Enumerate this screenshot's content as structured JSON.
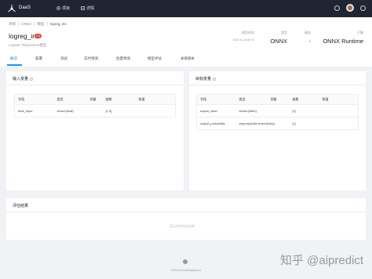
{
  "app": {
    "brand": "DaaS",
    "nav": [
      {
        "label": "项目",
        "icon": "project-icon"
      },
      {
        "label": "详情",
        "icon": "detail-icon"
      }
    ]
  },
  "breadcrumb": [
    "项目",
    "ONNX",
    "模型",
    "logreg_iris"
  ],
  "model": {
    "title": "logreg_iris",
    "badge": "1.0",
    "subtitle": "Logistic Regression模型",
    "meta": [
      {
        "label": "模型时间",
        "value": "",
        "small": "2019-11-18 05:14"
      },
      {
        "label": "类型",
        "value": "ONNX"
      },
      {
        "label": "服务",
        "value": "-"
      },
      {
        "label": "引擎",
        "value": "ONNX Runtime"
      }
    ]
  },
  "tabs": [
    "概况",
    "部署",
    "测试",
    "实时预测",
    "批量预测",
    "模型评估",
    "关联脚本"
  ],
  "input_vars": {
    "title": "输入变量",
    "columns": [
      "字段",
      "类型",
      "测量",
      "维数",
      "取值"
    ],
    "rows": [
      [
        "float_input",
        "tensor(float)",
        "",
        "[1,4]",
        ""
      ]
    ]
  },
  "target_vars": {
    "title": "目标变量",
    "columns": [
      "字段",
      "类型",
      "测量",
      "维数",
      "取值"
    ],
    "rows": [
      [
        "output_label",
        "tensor(int64)",
        "",
        "[1]",
        ""
      ],
      [
        "output_probability",
        "seq(map(int64,tensor(float)))",
        "",
        "[1]",
        ""
      ]
    ]
  },
  "eval": {
    "title": "评估结果",
    "empty": "暂无任何评估结果"
  },
  "footer": {
    "copyright": "©2019 AutoDeploy.AI"
  },
  "watermark": "知乎 @aipredict",
  "colors": {
    "topbar": "#1f2532",
    "accent": "#1890ff",
    "badge": "#e64545"
  }
}
